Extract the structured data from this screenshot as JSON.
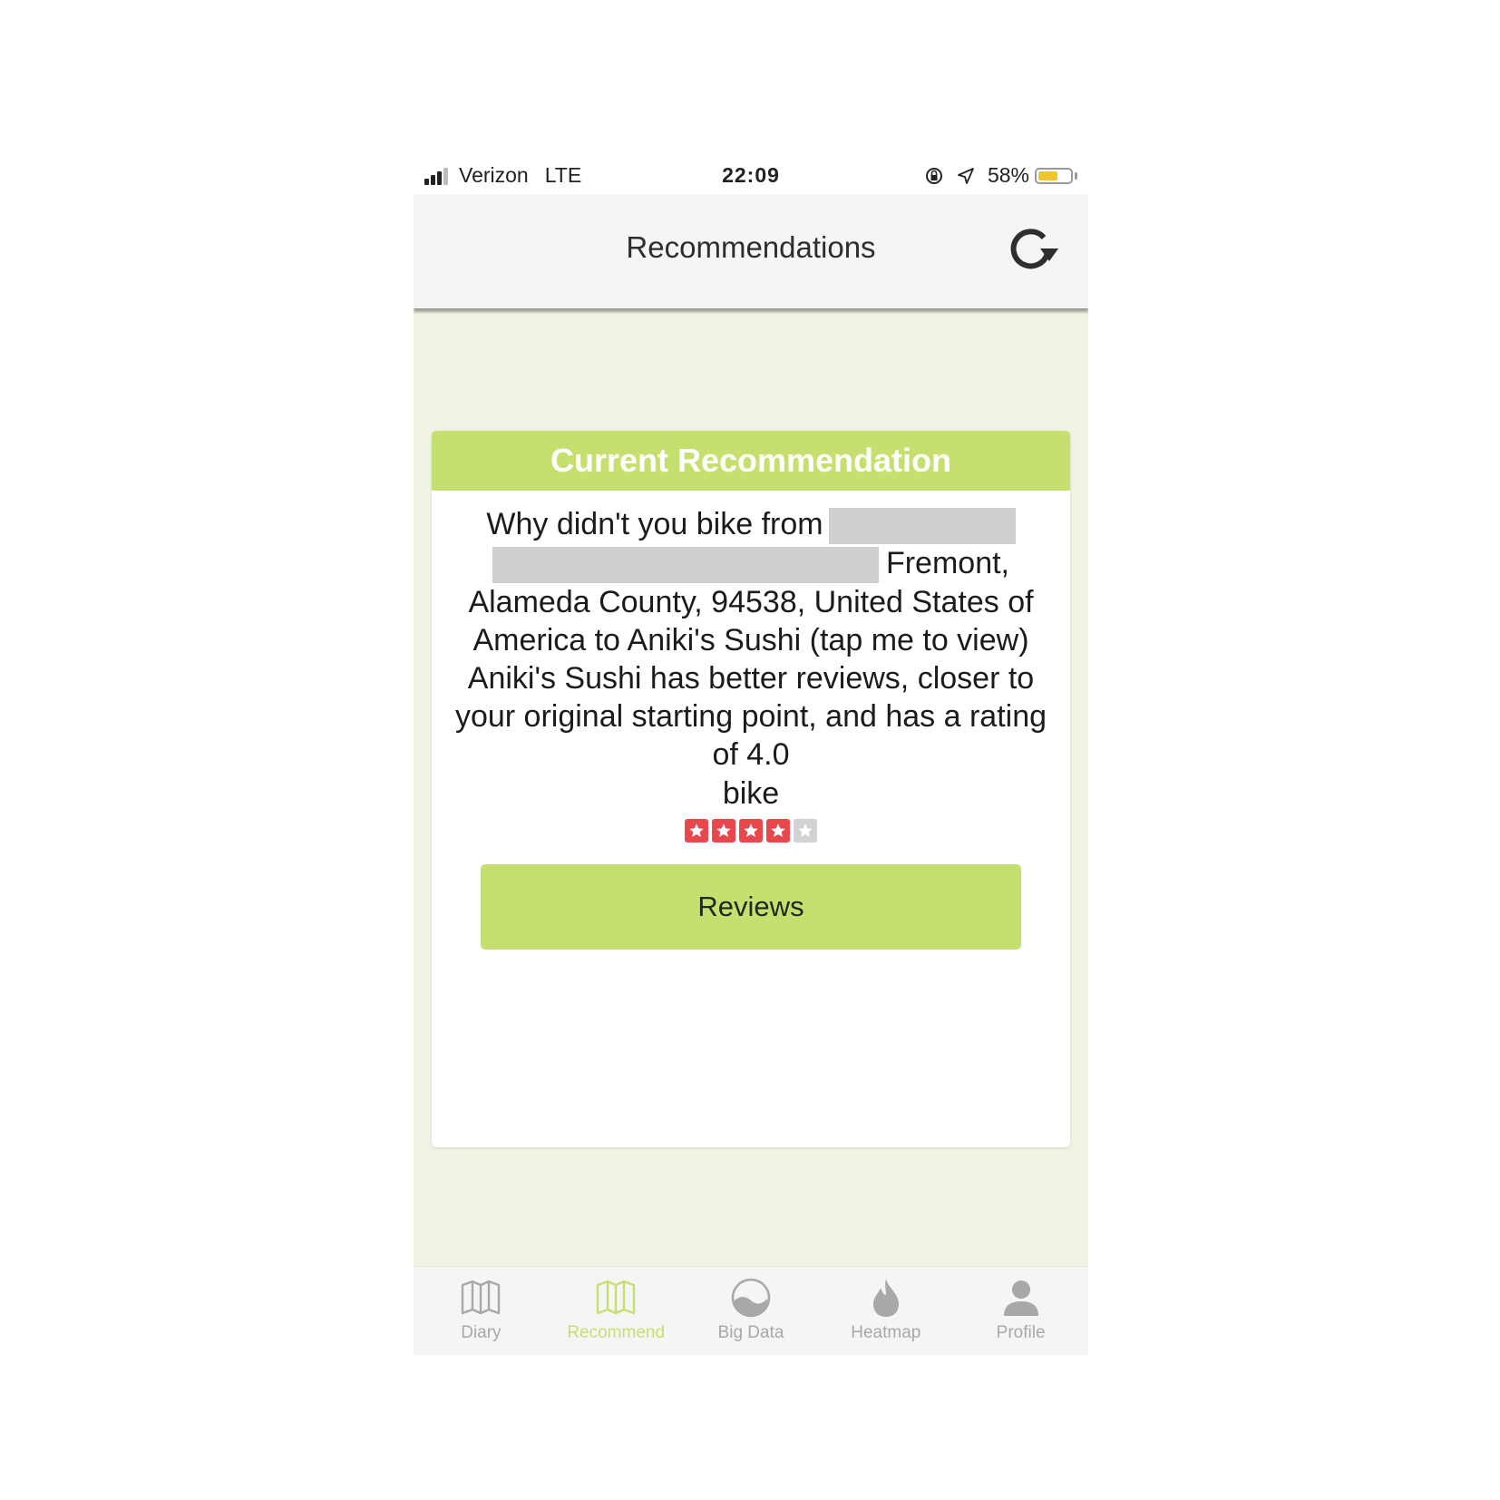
{
  "status_bar": {
    "carrier": "Verizon",
    "network": "LTE",
    "time": "22:09",
    "battery": "58%"
  },
  "nav": {
    "title": "Recommendations",
    "refresh_icon": "refresh-icon"
  },
  "card": {
    "header": "Current Recommendation",
    "message_start": "Why didn't you bike from",
    "message_rest": "Fremont, Alameda County, 94538, United States of America to Aniki's Sushi (tap me to view) Aniki's Sushi has better reviews, closer to your original starting point, and has a rating of 4.0",
    "mode": "bike",
    "rating": 4,
    "rating_max": 5,
    "reviews_button": "Reviews"
  },
  "tabs": [
    {
      "label": "Diary",
      "icon": "map-icon",
      "active": false
    },
    {
      "label": "Recommend",
      "icon": "map-icon",
      "active": true
    },
    {
      "label": "Big Data",
      "icon": "globe-icon",
      "active": false
    },
    {
      "label": "Heatmap",
      "icon": "flame-icon",
      "active": false
    },
    {
      "label": "Profile",
      "icon": "user-icon",
      "active": false
    }
  ],
  "colors": {
    "accent": "#c6e06f",
    "background": "#f0f3e3",
    "star": "#e8474b"
  }
}
